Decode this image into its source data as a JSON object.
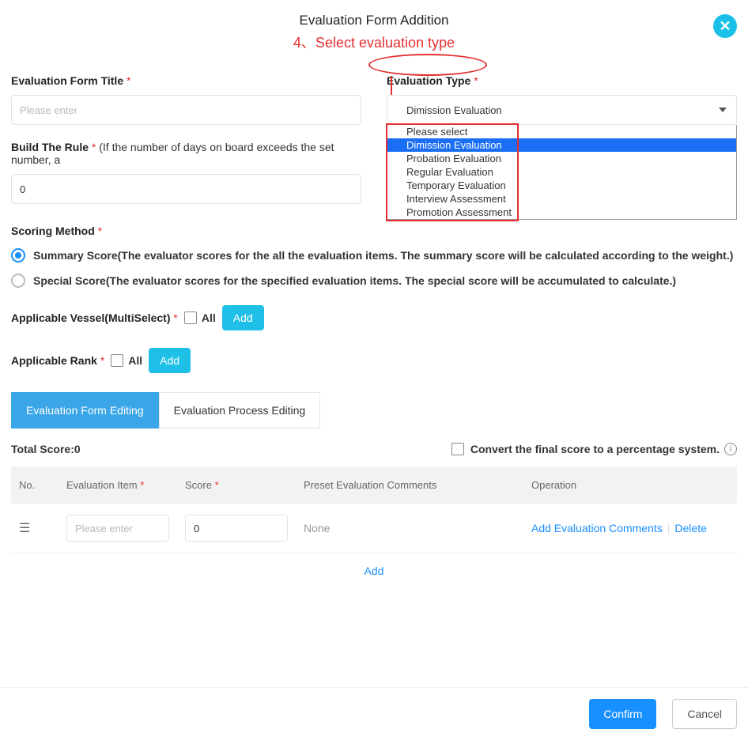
{
  "header": {
    "title": "Evaluation Form Addition",
    "annotation": "4、Select evaluation type"
  },
  "fields": {
    "form_title": {
      "label": "Evaluation Form Title",
      "placeholder": "Please enter"
    },
    "eval_type": {
      "label": "Evaluation Type",
      "selected": "Dimission Evaluation",
      "options": [
        "Please select",
        "Dimission Evaluation",
        "Probation Evaluation",
        "Regular Evaluation",
        "Temporary Evaluation",
        "Interview Assessment",
        "Promotion Assessment"
      ],
      "highlight_index": 1
    },
    "build_rule": {
      "label": "Build The Rule",
      "hint": "(If the number of days on board exceeds the set number, a",
      "value": "0"
    },
    "scoring": {
      "label": "Scoring Method",
      "summary": "Summary Score(The evaluator scores for the all the evaluation items. The summary score will be calculated according to the weight.)",
      "special": "Special Score(The evaluator scores for the specified evaluation items. The special score will be accumulated to calculate.)"
    },
    "vessel": {
      "label": "Applicable Vessel(MultiSelect)",
      "all": "All",
      "add": "Add"
    },
    "rank": {
      "label": "Applicable Rank",
      "all": "All",
      "add": "Add"
    }
  },
  "tabs": {
    "editing": "Evaluation Form Editing",
    "process": "Evaluation Process Editing"
  },
  "score_bar": {
    "total_label": "Total Score:",
    "total_value": "0",
    "convert": "Convert the final score to a percentage system."
  },
  "table": {
    "headers": {
      "no": "No.",
      "item": "Evaluation Item",
      "score": "Score",
      "preset": "Preset Evaluation Comments",
      "op": "Operation"
    },
    "row": {
      "item_placeholder": "Please enter",
      "score_value": "0",
      "preset_text": "None",
      "add_comments": "Add Evaluation Comments",
      "delete": "Delete"
    },
    "add": "Add"
  },
  "footer": {
    "confirm": "Confirm",
    "cancel": "Cancel"
  }
}
